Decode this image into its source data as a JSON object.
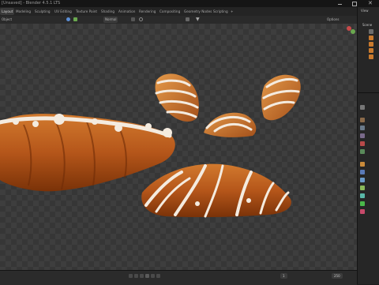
{
  "window": {
    "title": "[Unsaved] - Blender 4.5.1 LTS"
  },
  "menu": {
    "tabs": [
      "Layout",
      "Modeling",
      "Sculpting",
      "UV Editing",
      "Texture Paint",
      "Shading",
      "Animation",
      "Rendering",
      "Compositing",
      "Geometry Nodes",
      "Scripting"
    ],
    "add_tab": "+"
  },
  "viewport_header": {
    "object_label": "Object",
    "select_box": "Select Box",
    "transform": "Normal",
    "options": "Options"
  },
  "outliner": {
    "scene": "Scene",
    "view": "View"
  },
  "timeline": {
    "start": "1",
    "end": "250"
  },
  "colors": {
    "accent": "#4772b3",
    "crust": "#b85a1c",
    "icing": "#f4ebdf"
  }
}
